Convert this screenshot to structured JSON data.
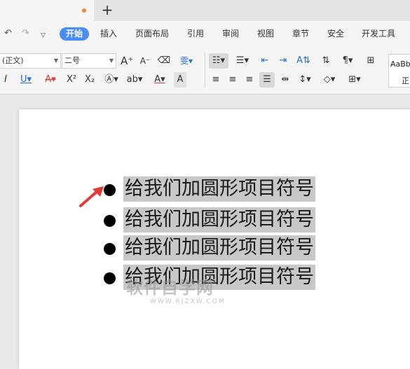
{
  "tab_bar": {
    "add_tab_label": "+"
  },
  "quick_access": {
    "undo_icon": "undo-icon",
    "redo_icon": "redo-icon",
    "customize_icon": "dropdown-caret-icon"
  },
  "menu": {
    "items": [
      "开始",
      "插入",
      "页面布局",
      "引用",
      "审阅",
      "视图",
      "章节",
      "安全",
      "开发工具"
    ],
    "active": "开始"
  },
  "toolbar": {
    "font_style_value": "(正文)",
    "font_size_value": "二号",
    "styles_sample": "AaBb",
    "styles_label": "正"
  },
  "document": {
    "lines": [
      "给我们加圆形项目符号",
      "给我们加圆形项目符号",
      "给我们加圆形项目符号",
      "给我们加圆形项目符号"
    ],
    "bullet_style": "filled-circle"
  },
  "watermark": {
    "text": "软件自学网",
    "subtext": "WWW.RJZXW.COM"
  },
  "colors": {
    "accent": "#4b8df8",
    "arrow": "#e53935",
    "selection": "#c8c8c8"
  }
}
